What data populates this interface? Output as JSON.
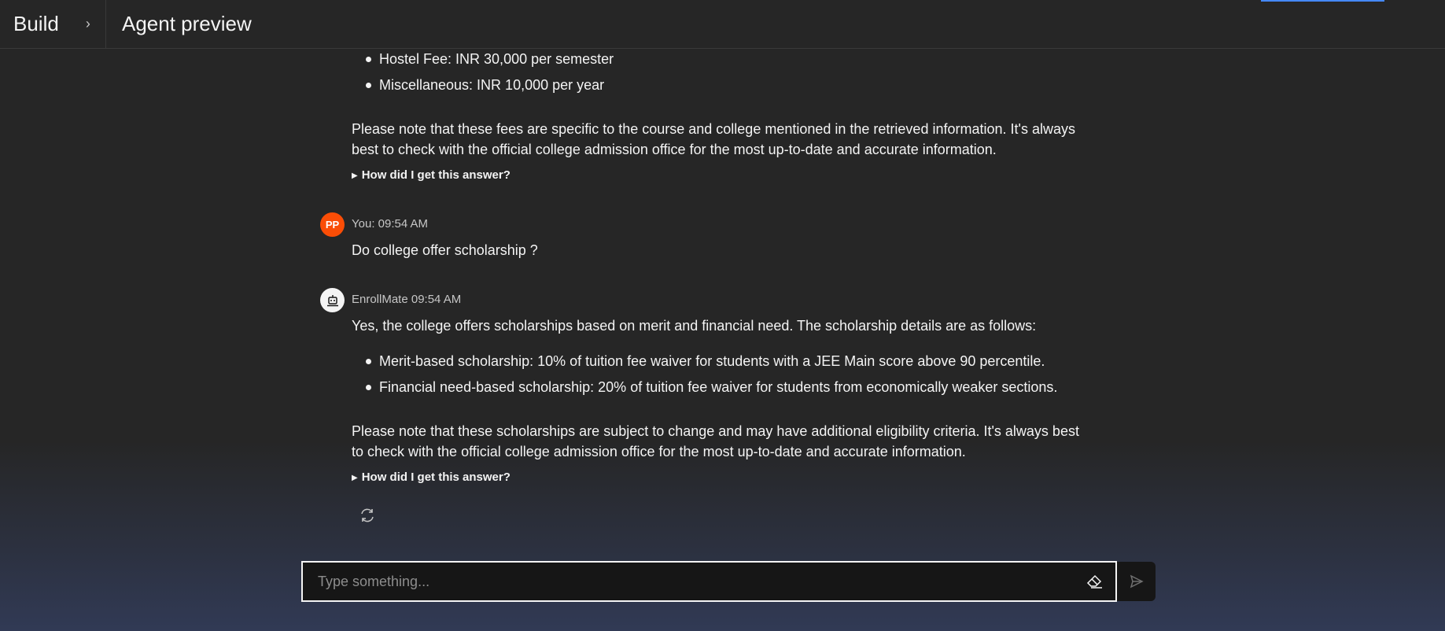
{
  "header": {
    "build_label": "Build",
    "chevron": "›",
    "title": "Agent preview"
  },
  "messages": {
    "prev_answer": {
      "bullets": [
        "Hostel Fee: INR 30,000 per semester",
        "Miscellaneous: INR 10,000 per year"
      ],
      "note": "Please note that these fees are specific to the course and college mentioned in the retrieved information. It's always best to check with the official college admission office for the most up-to-date and accurate information.",
      "how_label": "How did I get this answer?"
    },
    "user_msg": {
      "avatar_initials": "PP",
      "meta": "You: 09:54 AM",
      "text": "Do college offer scholarship ?"
    },
    "bot_msg": {
      "meta": "EnrollMate 09:54 AM",
      "intro": "Yes, the college offers scholarships based on merit and financial need. The scholarship details are as follows:",
      "bullets": [
        "Merit-based scholarship: 10% of tuition fee waiver for students with a JEE Main score above 90 percentile.",
        "Financial need-based scholarship: 20% of tuition fee waiver for students from economically weaker sections."
      ],
      "note": "Please note that these scholarships are subject to change and may have additional eligibility criteria. It's always best to check with the official college admission office for the most up-to-date and accurate information.",
      "how_label": "How did I get this answer?"
    }
  },
  "composer": {
    "placeholder": "Type something..."
  },
  "icons": {
    "chevron": "chevron-right-icon",
    "bot_avatar": "robot-icon",
    "regenerate": "refresh-icon",
    "clear": "eraser-icon",
    "send": "send-icon"
  },
  "colors": {
    "background": "#262626",
    "user_avatar": "#fa4d06",
    "accent": "#4589ff"
  }
}
